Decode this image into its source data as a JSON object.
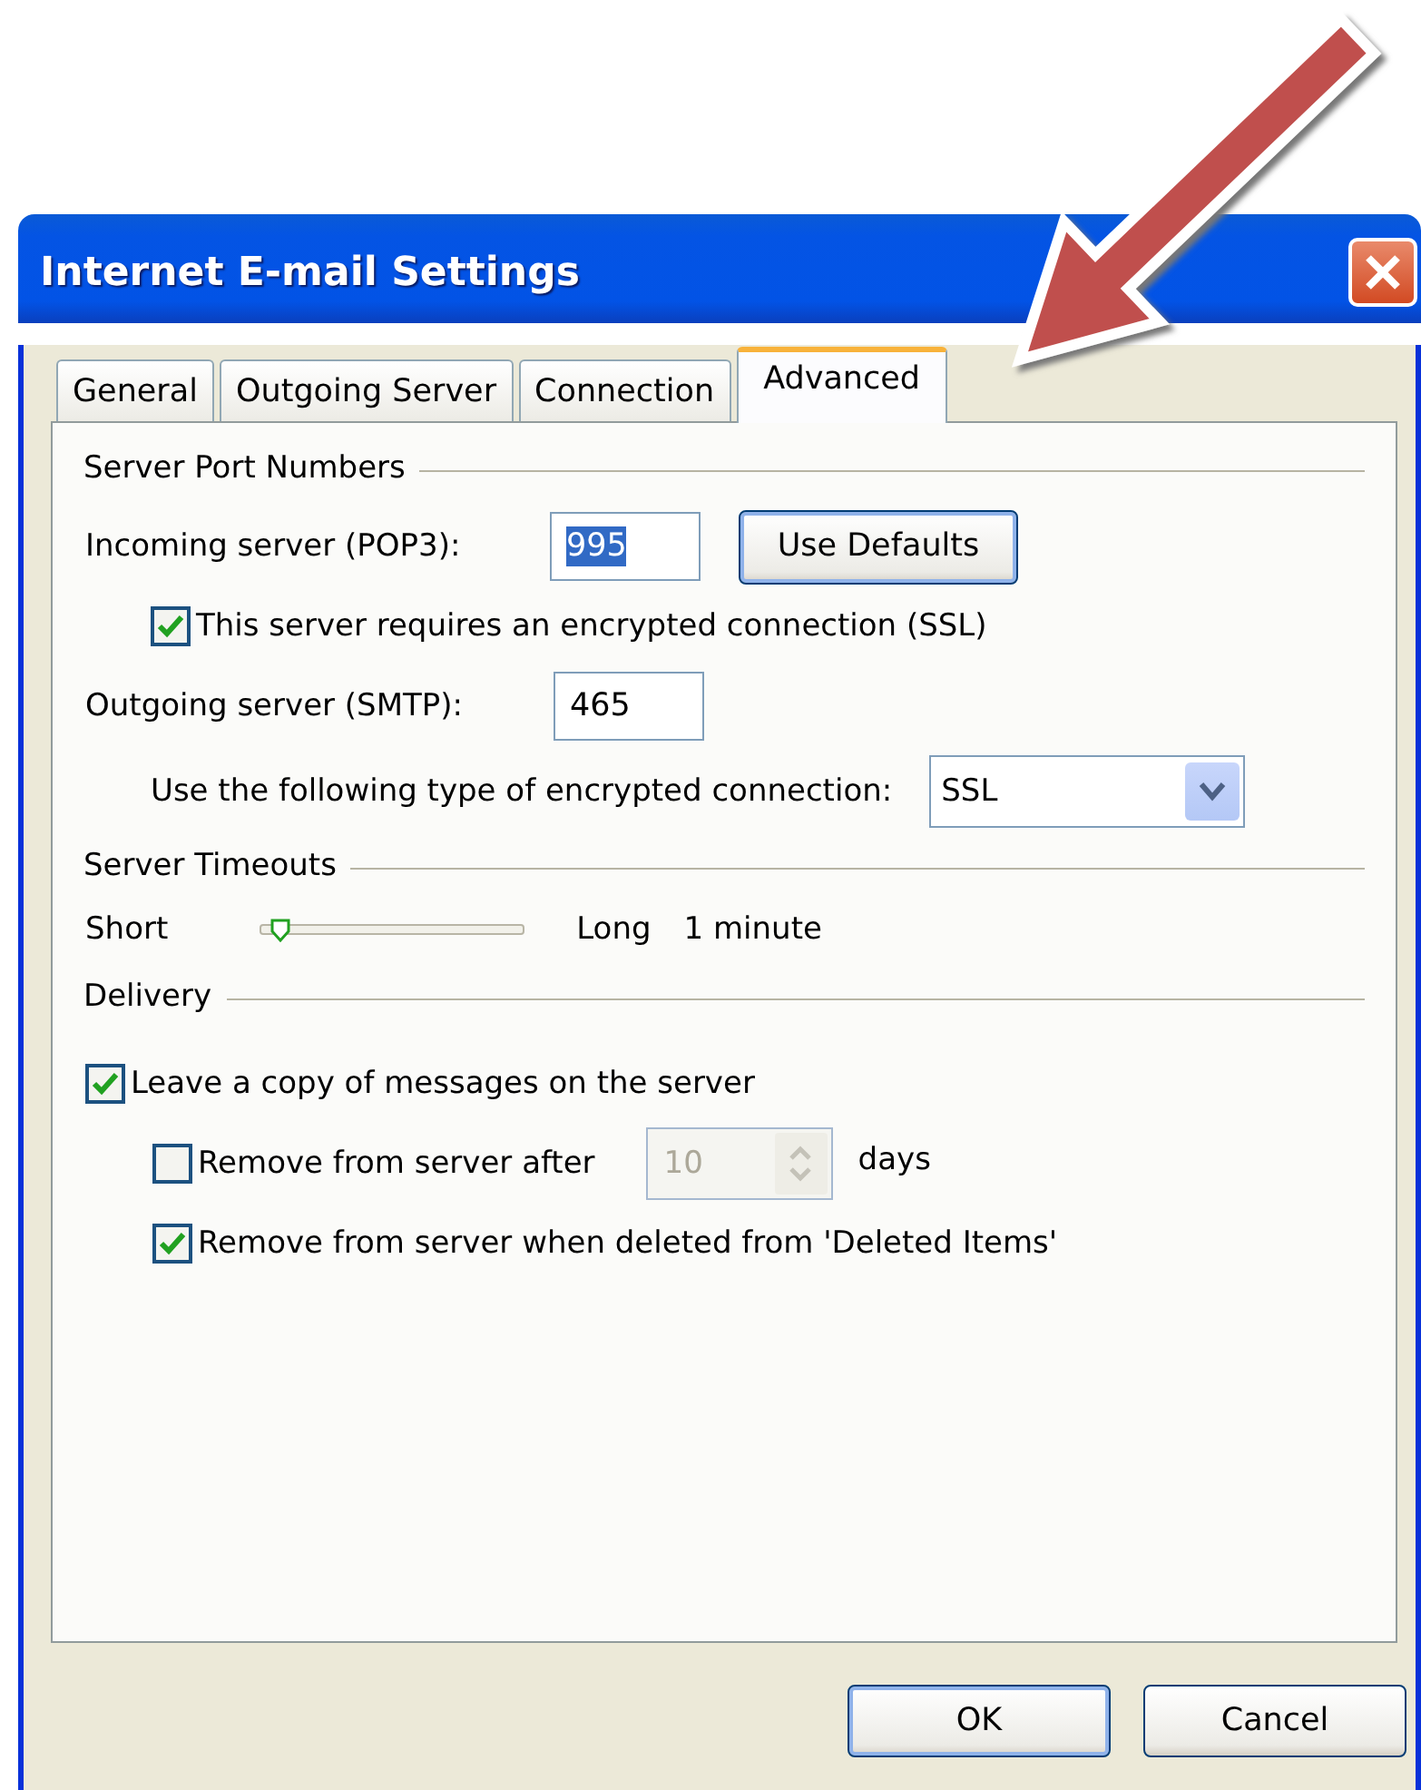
{
  "window": {
    "title": "Internet E-mail Settings"
  },
  "tabs": [
    {
      "label": "General",
      "selected": false
    },
    {
      "label": "Outgoing Server",
      "selected": false
    },
    {
      "label": "Connection",
      "selected": false
    },
    {
      "label": "Advanced",
      "selected": true
    }
  ],
  "port_section": {
    "title": "Server Port Numbers",
    "incoming_label": "Incoming server (POP3):",
    "incoming_field": {
      "value": "995",
      "selected": true
    },
    "use_defaults_button": "Use Defaults",
    "ssl_checkbox": {
      "label": "This server requires an encrypted connection (SSL)",
      "checked": true
    },
    "outgoing_label": "Outgoing server (SMTP):",
    "outgoing_field": {
      "value": "465",
      "selected": false
    },
    "encryption_label": "Use the following type of encrypted connection:",
    "encryption_value": "SSL"
  },
  "timeouts_section": {
    "title": "Server Timeouts",
    "min_label": "Short",
    "max_label": "Long",
    "level": 0.05,
    "reading": "1 minute"
  },
  "delivery_section": {
    "title": "Delivery",
    "options": [
      {
        "label": "Leave a copy of messages on the server",
        "checked": true,
        "children": [
          {
            "label": "Remove from server after",
            "checked": false,
            "spinner": {
              "value": "10",
              "disabled": true
            },
            "unit": "days"
          },
          {
            "label": "Remove from server when deleted from 'Deleted Items'",
            "checked": true
          }
        ]
      }
    ]
  },
  "buttons": [
    {
      "label": "OK",
      "default": true
    },
    {
      "label": "Cancel",
      "default": false
    }
  ]
}
